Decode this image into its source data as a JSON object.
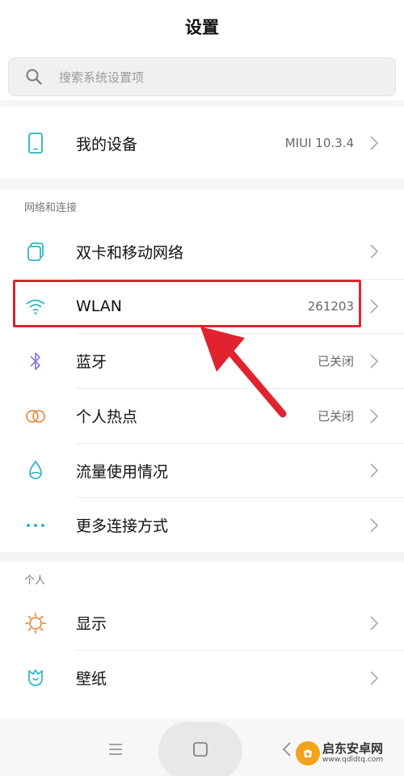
{
  "header": {
    "title": "设置"
  },
  "search": {
    "placeholder": "搜索系统设置项",
    "icon": "search-icon"
  },
  "my_device": {
    "label": "我的设备",
    "value": "MIUI 10.3.4",
    "icon": "phone-icon"
  },
  "sections": {
    "network": "网络和连接",
    "personal": "个人"
  },
  "network_items": [
    {
      "label": "双卡和移动网络",
      "value": "",
      "icon": "sim-icon"
    },
    {
      "label": "WLAN",
      "value": "261203",
      "icon": "wifi-icon"
    },
    {
      "label": "蓝牙",
      "value": "已关闭",
      "icon": "bluetooth-icon"
    },
    {
      "label": "个人热点",
      "value": "已关闭",
      "icon": "hotspot-icon"
    },
    {
      "label": "流量使用情况",
      "value": "",
      "icon": "data-usage-icon"
    },
    {
      "label": "更多连接方式",
      "value": "",
      "icon": "more-icon"
    }
  ],
  "personal_items": [
    {
      "label": "显示",
      "value": "",
      "icon": "display-icon"
    },
    {
      "label": "壁纸",
      "value": "",
      "icon": "wallpaper-icon"
    }
  ],
  "watermark": {
    "name": "启东安卓网",
    "url": "www.qdldtq.com"
  },
  "colors": {
    "accent_teal": "#2bb3c0",
    "highlight_red": "#e0232e",
    "bluetooth_purple": "#8f7ad6",
    "orange": "#f0883a"
  }
}
